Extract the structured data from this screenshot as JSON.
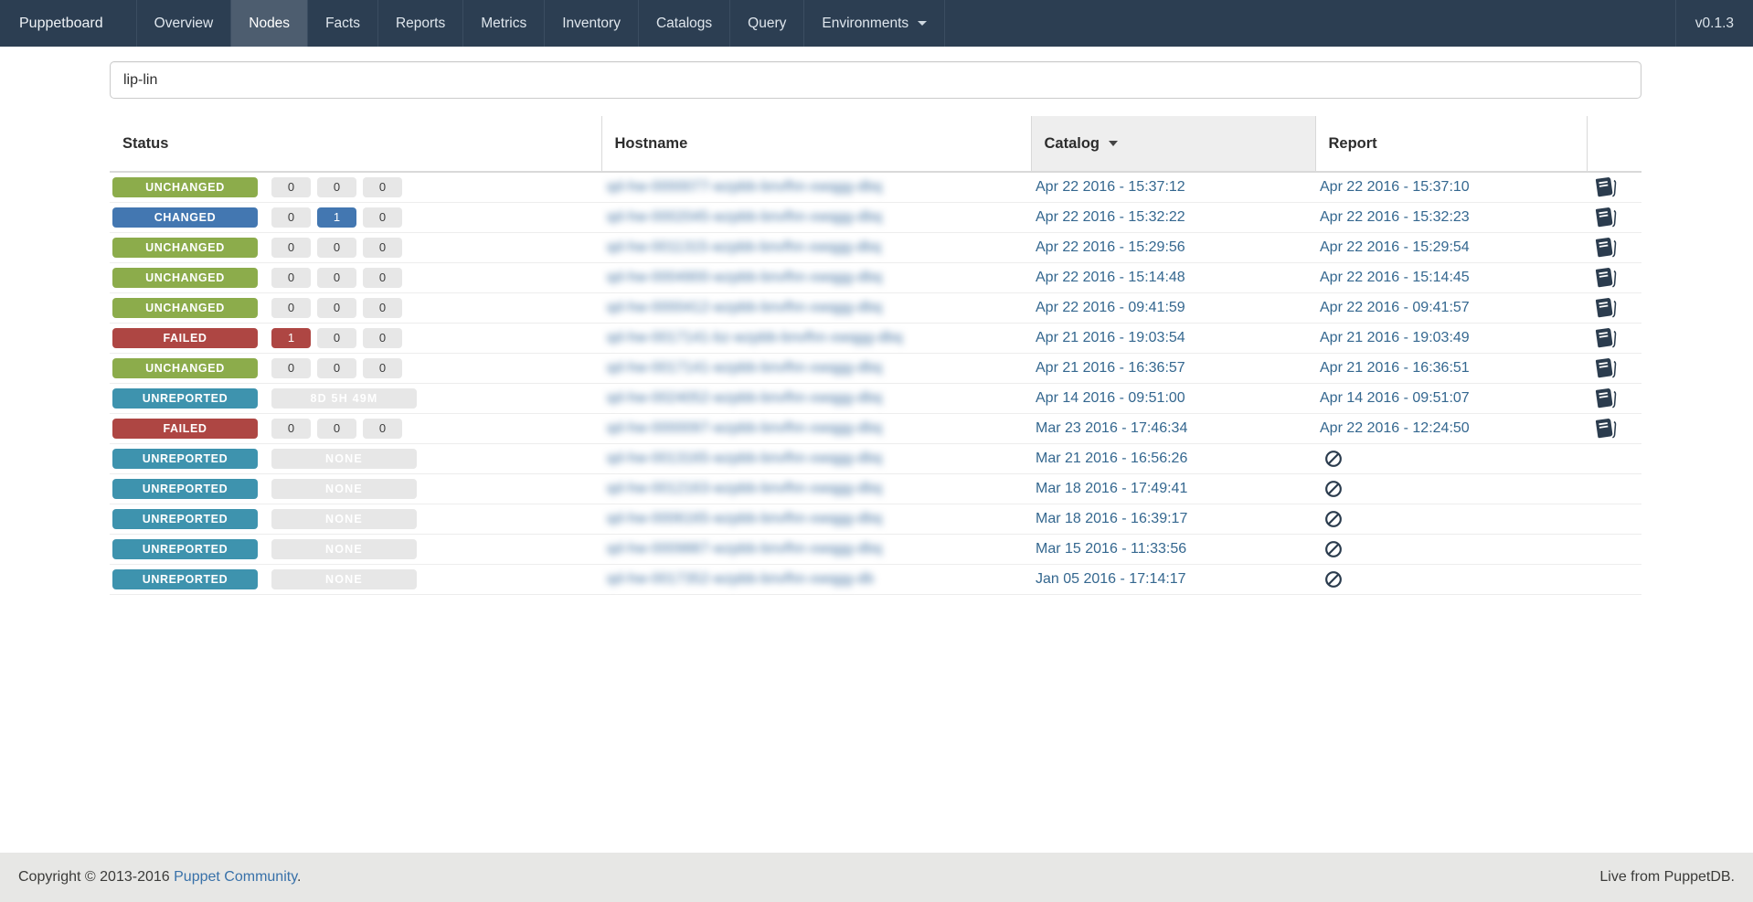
{
  "navbar": {
    "brand": "Puppetboard",
    "version": "v0.1.3",
    "items": [
      {
        "label": "Overview",
        "active": false,
        "dropdown": false
      },
      {
        "label": "Nodes",
        "active": true,
        "dropdown": false
      },
      {
        "label": "Facts",
        "active": false,
        "dropdown": false
      },
      {
        "label": "Reports",
        "active": false,
        "dropdown": false
      },
      {
        "label": "Metrics",
        "active": false,
        "dropdown": false
      },
      {
        "label": "Inventory",
        "active": false,
        "dropdown": false
      },
      {
        "label": "Catalogs",
        "active": false,
        "dropdown": false
      },
      {
        "label": "Query",
        "active": false,
        "dropdown": false
      },
      {
        "label": "Environments",
        "active": false,
        "dropdown": true
      }
    ]
  },
  "search": {
    "value": "lip-lin",
    "placeholder": ""
  },
  "table": {
    "columns": [
      "Status",
      "Hostname",
      "Catalog",
      "Report"
    ],
    "sort": {
      "column": "Catalog",
      "direction": "desc"
    },
    "hostname_redacted": true,
    "rows": [
      {
        "status": "UNCHANGED",
        "variant": "unchanged",
        "counts": [
          {
            "value": "0",
            "variant": "default"
          },
          {
            "value": "0",
            "variant": "default"
          },
          {
            "value": "0",
            "variant": "default"
          }
        ],
        "wide_count": null,
        "hostname_mask": "qd-hw-0000077-wzpbb-bnvfhn-xwqgg-dbq",
        "catalog": "Apr 22 2016 - 15:37:12",
        "report": "Apr 22 2016 - 15:37:10"
      },
      {
        "status": "CHANGED",
        "variant": "changed",
        "counts": [
          {
            "value": "0",
            "variant": "default"
          },
          {
            "value": "1",
            "variant": "changed"
          },
          {
            "value": "0",
            "variant": "default"
          }
        ],
        "wide_count": null,
        "hostname_mask": "qd-hw-0002045-wzpbb-bnvfhn-xwqgg-dbq",
        "catalog": "Apr 22 2016 - 15:32:22",
        "report": "Apr 22 2016 - 15:32:23"
      },
      {
        "status": "UNCHANGED",
        "variant": "unchanged",
        "counts": [
          {
            "value": "0",
            "variant": "default"
          },
          {
            "value": "0",
            "variant": "default"
          },
          {
            "value": "0",
            "variant": "default"
          }
        ],
        "wide_count": null,
        "hostname_mask": "qd-hw-0011315-wzpbb-bnvfhn-xwqgg-dbq",
        "catalog": "Apr 22 2016 - 15:29:56",
        "report": "Apr 22 2016 - 15:29:54"
      },
      {
        "status": "UNCHANGED",
        "variant": "unchanged",
        "counts": [
          {
            "value": "0",
            "variant": "default"
          },
          {
            "value": "0",
            "variant": "default"
          },
          {
            "value": "0",
            "variant": "default"
          }
        ],
        "wide_count": null,
        "hostname_mask": "qd-hw-0004900-wzpbb-bnvfhn-xwqgg-dbq",
        "catalog": "Apr 22 2016 - 15:14:48",
        "report": "Apr 22 2016 - 15:14:45"
      },
      {
        "status": "UNCHANGED",
        "variant": "unchanged",
        "counts": [
          {
            "value": "0",
            "variant": "default"
          },
          {
            "value": "0",
            "variant": "default"
          },
          {
            "value": "0",
            "variant": "default"
          }
        ],
        "wide_count": null,
        "hostname_mask": "qd-hw-0000412-wzpbb-bnvfhn-xwqgg-dbq",
        "catalog": "Apr 22 2016 - 09:41:59",
        "report": "Apr 22 2016 - 09:41:57"
      },
      {
        "status": "FAILED",
        "variant": "failed",
        "counts": [
          {
            "value": "1",
            "variant": "failed"
          },
          {
            "value": "0",
            "variant": "default"
          },
          {
            "value": "0",
            "variant": "default"
          }
        ],
        "wide_count": null,
        "hostname_mask": "qd-hw-0017141-bz-wzpbb-bnvfhn-xwqgg-dbq",
        "catalog": "Apr 21 2016 - 19:03:54",
        "report": "Apr 21 2016 - 19:03:49"
      },
      {
        "status": "UNCHANGED",
        "variant": "unchanged",
        "counts": [
          {
            "value": "0",
            "variant": "default"
          },
          {
            "value": "0",
            "variant": "default"
          },
          {
            "value": "0",
            "variant": "default"
          }
        ],
        "wide_count": null,
        "hostname_mask": "qd-hw-0017141-wzpbb-bnvfhn-xwqgg-dbq",
        "catalog": "Apr 21 2016 - 16:36:57",
        "report": "Apr 21 2016 - 16:36:51"
      },
      {
        "status": "UNREPORTED",
        "variant": "unreported",
        "counts": [],
        "wide_count": "8D 5H 49M",
        "hostname_mask": "qd-hw-0024052-wzpbb-bnvfhn-xwqgg-dbq",
        "catalog": "Apr 14 2016 - 09:51:00",
        "report": "Apr 14 2016 - 09:51:07"
      },
      {
        "status": "FAILED",
        "variant": "failed",
        "counts": [
          {
            "value": "0",
            "variant": "default"
          },
          {
            "value": "0",
            "variant": "default"
          },
          {
            "value": "0",
            "variant": "default"
          }
        ],
        "wide_count": null,
        "hostname_mask": "qd-hw-0000097-wzpbb-bnvfhn-xwqgg-dbq",
        "catalog": "Mar 23 2016 - 17:46:34",
        "report": "Apr 22 2016 - 12:24:50"
      },
      {
        "status": "UNREPORTED",
        "variant": "unreported",
        "counts": [],
        "wide_count": "NONE",
        "hostname_mask": "qd-hw-0013165-wzpbb-bnvfhn-xwqgg-dbq",
        "catalog": "Mar 21 2016 - 16:56:26",
        "report": null
      },
      {
        "status": "UNREPORTED",
        "variant": "unreported",
        "counts": [],
        "wide_count": "NONE",
        "hostname_mask": "qd-hw-0012163-wzpbb-bnvfhn-xwqgg-dbq",
        "catalog": "Mar 18 2016 - 17:49:41",
        "report": null
      },
      {
        "status": "UNREPORTED",
        "variant": "unreported",
        "counts": [],
        "wide_count": "NONE",
        "hostname_mask": "qd-hw-0006165-wzpbb-bnvfhn-xwqgg-dbq",
        "catalog": "Mar 18 2016 - 16:39:17",
        "report": null
      },
      {
        "status": "UNREPORTED",
        "variant": "unreported",
        "counts": [],
        "wide_count": "NONE",
        "hostname_mask": "qd-hw-0009887-wzpbb-bnvfhn-xwqgg-dbq",
        "catalog": "Mar 15 2016 - 11:33:56",
        "report": null
      },
      {
        "status": "UNREPORTED",
        "variant": "unreported",
        "counts": [],
        "wide_count": "NONE",
        "hostname_mask": "qd-hw-0017352-wzpbb-bnvfhn-xwqgg-db",
        "catalog": "Jan 05 2016 - 17:14:17",
        "report": null
      }
    ]
  },
  "footer": {
    "copyright": "Copyright © 2013-2016",
    "link": "Puppet Community",
    "suffix": ".",
    "right": "Live from PuppetDB."
  },
  "colors": {
    "navbar_bg": "#2c3e52",
    "navbar_active_bg": "#4d5d6f",
    "badge_unchanged": "#8cac4b",
    "badge_changed": "#4377b1",
    "badge_failed": "#ae4643",
    "badge_unreported": "#3e93ae",
    "count_box_bg": "#e7e7e7",
    "sorted_header_bg": "#eeeeee",
    "timestamp_link": "#34678f",
    "footer_bg": "#e7e7e5",
    "footer_link": "#3871a9",
    "icon": "#2b3c4e"
  }
}
